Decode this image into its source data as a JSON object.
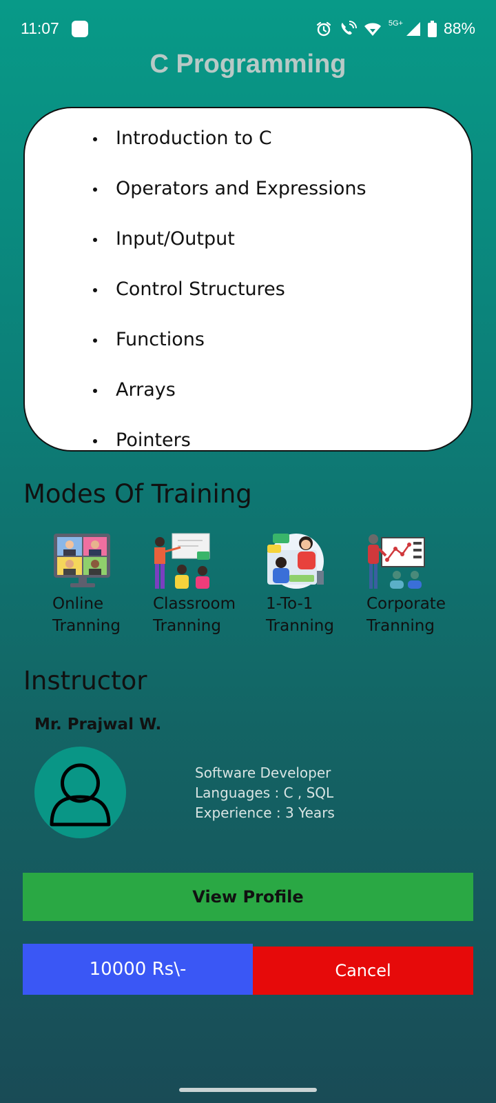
{
  "status_bar": {
    "time": "11:07",
    "network": "5G+",
    "battery": "88%"
  },
  "page_title": "C Programming",
  "topics": [
    "Introduction to C",
    "Operators and Expressions",
    "Input/Output",
    "Control Structures",
    "Functions",
    "Arrays",
    "Pointers"
  ],
  "modes": {
    "heading": "Modes Of Training",
    "items": [
      {
        "label": "Online\nTranning",
        "icon": "video-conference-icon"
      },
      {
        "label": "Classroom\nTranning",
        "icon": "classroom-icon"
      },
      {
        "label": "1-To-1\nTranning",
        "icon": "one-to-one-icon"
      },
      {
        "label": "Corporate\nTranning",
        "icon": "corporate-presentation-icon"
      }
    ]
  },
  "instructor": {
    "heading": "Instructor",
    "name": "Mr. Prajwal W.",
    "role": "Software Developer",
    "languages": "Languages : C , SQL",
    "experience": "Experience : 3 Years",
    "avatar_icon": "user-avatar-icon"
  },
  "buttons": {
    "view_profile": "View Profile",
    "price": "10000 Rs\\-",
    "cancel": "Cancel"
  },
  "colors": {
    "view_profile_bg": "#2aa844",
    "price_bg": "#3a57f5",
    "cancel_bg": "#e60a0a",
    "avatar_bg": "#099686"
  }
}
